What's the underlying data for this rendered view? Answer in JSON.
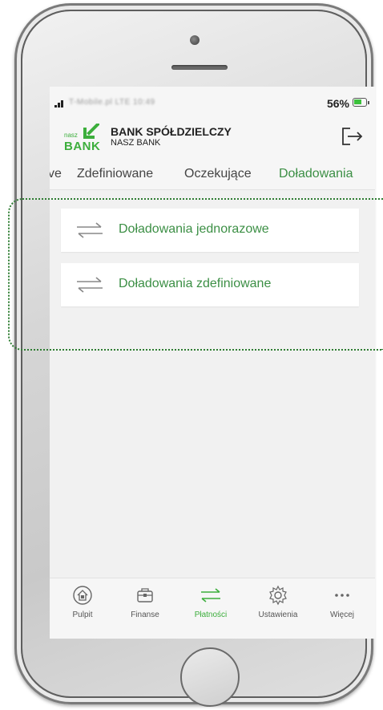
{
  "status_bar": {
    "carrier": "T-Mobile.pl LTE  10:49",
    "battery": "56%"
  },
  "header": {
    "logo_small": "nasz",
    "logo_big": "BANK",
    "bank_name": "BANK SPÓŁDZIELCZY",
    "bank_sub": "NASZ BANK",
    "logout_icon": "logout-icon"
  },
  "tabs": [
    {
      "label": "ve",
      "active": false
    },
    {
      "label": "Zdefiniowane",
      "active": false
    },
    {
      "label": "Oczekujące",
      "active": false
    },
    {
      "label": "Doładowania",
      "active": true
    }
  ],
  "cards": [
    {
      "label": "Doładowania jednorazowe",
      "icon": "swap-arrows-icon"
    },
    {
      "label": "Doładowania zdefiniowane",
      "icon": "swap-arrows-icon"
    }
  ],
  "nav": [
    {
      "label": "Pulpit",
      "icon": "home-icon",
      "active": false
    },
    {
      "label": "Finanse",
      "icon": "wallet-icon",
      "active": false
    },
    {
      "label": "Płatności",
      "icon": "swap-arrows-icon",
      "active": true
    },
    {
      "label": "Ustawienia",
      "icon": "gear-icon",
      "active": false
    },
    {
      "label": "Więcej",
      "icon": "more-icon",
      "active": false
    }
  ],
  "colors": {
    "accent": "#3c8f45",
    "nav_active": "#3cae3c",
    "frame": "#2e7d32"
  }
}
